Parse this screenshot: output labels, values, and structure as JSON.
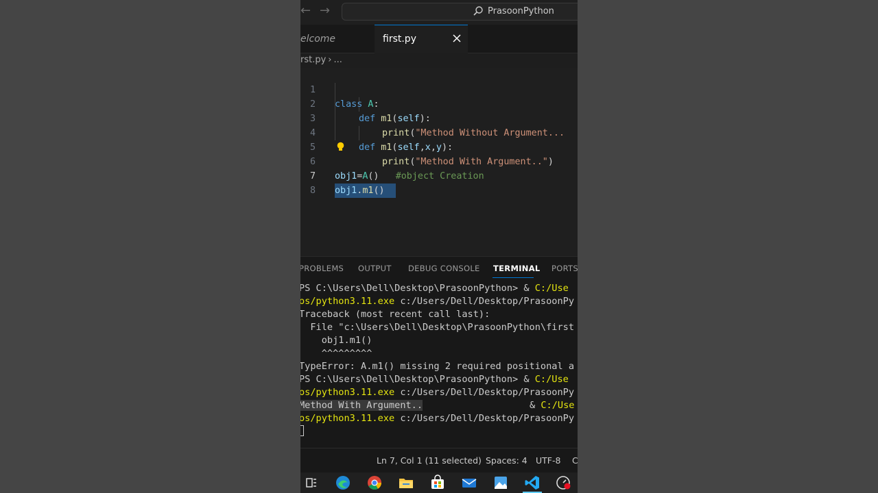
{
  "search": {
    "text": "PrasoonPython"
  },
  "tabs": [
    {
      "label": "elcome"
    },
    {
      "label": "first.py"
    }
  ],
  "breadcrumb": {
    "file": "rst.py",
    "more": "..."
  },
  "editor": {
    "lines": [
      {
        "num": "1"
      },
      {
        "num": "2"
      },
      {
        "num": "3"
      },
      {
        "num": "4"
      },
      {
        "num": "5"
      },
      {
        "num": "6"
      },
      {
        "num": "7"
      },
      {
        "num": "8"
      }
    ],
    "tokens": {
      "l1_kw": "class",
      "l1_cls": "A",
      "l1_p": ":",
      "l2_kw": "def",
      "l2_fn": "m1",
      "l2_p1": "(",
      "l2_self": "self",
      "l2_p2": "):",
      "l3_fn": "print",
      "l3_p1": "(",
      "l3_str": "\"Method Without Argument...",
      "l4_kw": "def",
      "l4_fn": "m1",
      "l4_p1": "(",
      "l4_self": "self",
      "l4_c1": ",",
      "l4_x": "x",
      "l4_c2": ",",
      "l4_y": "y",
      "l4_p2": "):",
      "l5_fn": "print",
      "l5_p1": "(",
      "l5_str": "\"Method With Argument..\"",
      "l5_p2": ")",
      "l6_var": "obj1",
      "l6_eq": "=",
      "l6_cls": "A",
      "l6_p": "()",
      "l6_cmt": "#object Creation",
      "l7_var": "obj1",
      "l7_dot": ".",
      "l7_fn": "m1",
      "l7_p": "()"
    }
  },
  "panel": {
    "tabs": [
      "PROBLEMS",
      "OUTPUT",
      "DEBUG CONSOLE",
      "TERMINAL",
      "PORTS"
    ],
    "active_tab": "TERMINAL"
  },
  "terminal": {
    "l1a": "PS C:\\Users\\Dell\\Desktop\\PrasoonPython> & ",
    "l1b": "C:/Use",
    "l2a": "os/python3.11.exe",
    "l2b": " c:/Users/Dell/Desktop/PrasoonPy",
    "l3": "Traceback (most recent call last):",
    "l4": "  File \"c:\\Users\\Dell\\Desktop\\PrasoonPython\\first",
    "l5": "    obj1.m1()",
    "l6": "    ^^^^^^^^^",
    "l7": "TypeError: A.m1() missing 2 required positional a",
    "l8a": "PS C:\\Users\\Dell\\Desktop\\PrasoonPython> & ",
    "l8b": "C:/Use",
    "l9a": "os/python3.11.exe",
    "l9b": " c:/Users/Dell/Desktop/PrasoonPy",
    "l10": "Method With Argument..",
    "l10r1": "& ",
    "l10r2": "C:/Use",
    "l11a": "os/python3.11.exe",
    "l11b": " c:/Users/Dell/Desktop/PrasoonPy"
  },
  "status": {
    "position": "Ln 7, Col 1 (11 selected)",
    "spaces": "Spaces: 4",
    "encoding": "UTF-8",
    "extra": "C"
  },
  "colors": {
    "accent": "#0078d4",
    "terminal_path": "#e5e510",
    "selection": "#264f78"
  },
  "taskbar": {
    "icons": [
      "task-view-icon",
      "edge-icon",
      "chrome-icon",
      "file-explorer-icon",
      "store-icon",
      "mail-icon",
      "photos-icon",
      "vscode-icon",
      "recorder-icon"
    ]
  }
}
